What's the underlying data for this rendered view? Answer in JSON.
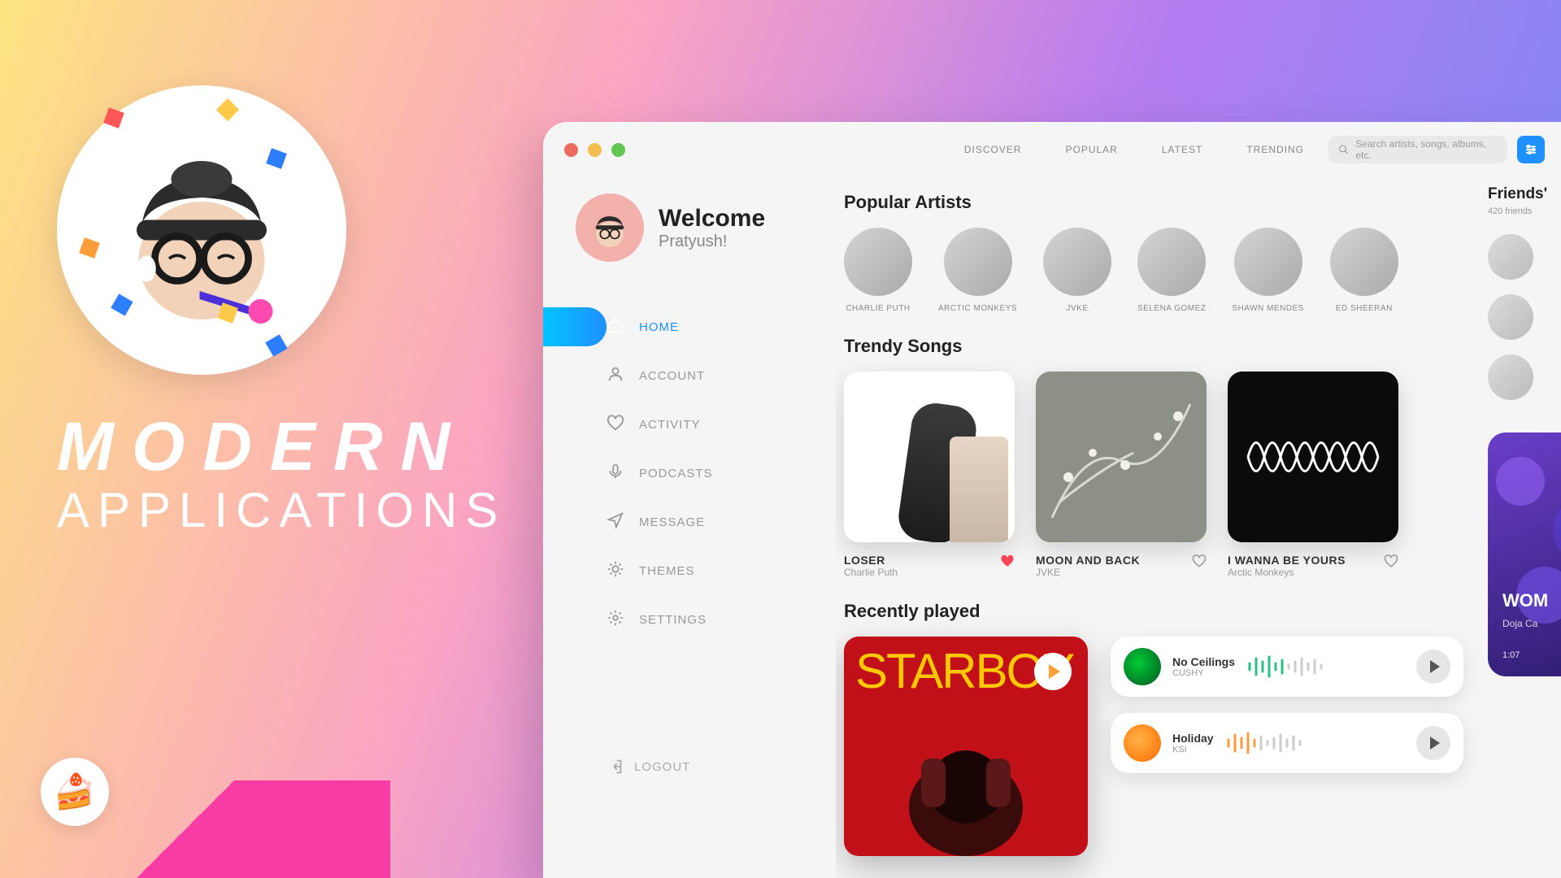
{
  "promo": {
    "title": "MODERN",
    "subtitle": "APPLICATIONS",
    "cake_emoji": "🍰"
  },
  "header": {
    "nav": [
      "DISCOVER",
      "POPULAR",
      "LATEST",
      "TRENDING"
    ],
    "search_placeholder": "Search artists, songs, albums, etc."
  },
  "user": {
    "welcome": "Welcome",
    "name": "Pratyush!"
  },
  "sidebar": {
    "items": [
      {
        "label": "HOME",
        "icon": "home-icon",
        "active": true
      },
      {
        "label": "ACCOUNT",
        "icon": "user-icon"
      },
      {
        "label": "ACTIVITY",
        "icon": "heart-icon"
      },
      {
        "label": "PODCASTS",
        "icon": "mic-icon"
      },
      {
        "label": "MESSAGE",
        "icon": "send-icon"
      },
      {
        "label": "THEMES",
        "icon": "theme-icon"
      },
      {
        "label": "SETTINGS",
        "icon": "settings-icon"
      }
    ],
    "logout": "LOGOUT"
  },
  "sections": {
    "artists_title": "Popular Artists",
    "songs_title": "Trendy Songs",
    "recent_title": "Recently played"
  },
  "artists": [
    {
      "name": "CHARLIE PUTH"
    },
    {
      "name": "ARCTIC MONKEYS"
    },
    {
      "name": "JVKE"
    },
    {
      "name": "SELENA GOMEZ"
    },
    {
      "name": "SHAWN MENDES"
    },
    {
      "name": "ED SHEERAN"
    }
  ],
  "songs": [
    {
      "title": "LOSER",
      "artist": "Charlie Puth",
      "liked": true
    },
    {
      "title": "MOON AND BACK",
      "artist": "JVKE",
      "liked": false
    },
    {
      "title": "I WANNA BE YOURS",
      "artist": "Arctic Monkeys",
      "liked": false
    }
  ],
  "recent_hero": {
    "title": "STARBOY"
  },
  "recent_list": [
    {
      "title": "No Ceilings",
      "artist": "CUSHY",
      "wave_color": "#26c281"
    },
    {
      "title": "Holiday",
      "artist": "KSI",
      "wave_color": "#ff9a3c"
    }
  ],
  "friends": {
    "title": "Friends'",
    "subtitle": "420 friends",
    "list": [
      {
        "name": "friend-1"
      },
      {
        "name": "friend-2"
      },
      {
        "name": "friend-3"
      }
    ]
  },
  "now_playing": {
    "title": "WOM",
    "artist": "Doja Ca",
    "time": "1:07"
  }
}
